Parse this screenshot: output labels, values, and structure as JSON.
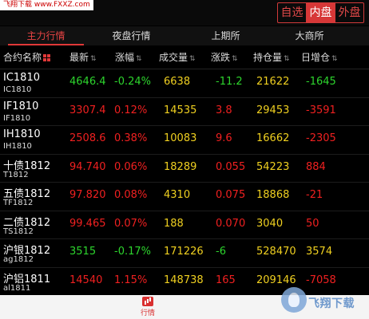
{
  "watermark_top": "飞翔下载 www.FXXZ.com",
  "market_segments": [
    {
      "label": "自选",
      "active": false
    },
    {
      "label": "内盘",
      "active": true
    },
    {
      "label": "外盘",
      "active": false
    }
  ],
  "exchange_tabs": [
    {
      "label": "主力行情",
      "active": true
    },
    {
      "label": "夜盘行情",
      "active": false
    },
    {
      "label": "上期所",
      "active": false
    },
    {
      "label": "大商所",
      "active": false
    }
  ],
  "columns": {
    "name": "合约名称",
    "last": "最新",
    "change_pct": "涨幅",
    "volume": "成交量",
    "change": "涨跌",
    "open_interest": "持仓量",
    "oi_change": "日增仓",
    "sort_glyph": "⇅"
  },
  "rows": [
    {
      "name": "IC1810",
      "code": "IC1810",
      "last": "4646.4",
      "change_pct": "-0.24%",
      "volume": "6638",
      "change": "-11.2",
      "open_interest": "21622",
      "oi_change": "-1645",
      "direction": "down"
    },
    {
      "name": "IF1810",
      "code": "IF1810",
      "last": "3307.4",
      "change_pct": "0.12%",
      "volume": "14535",
      "change": "3.8",
      "open_interest": "29453",
      "oi_change": "-3591",
      "direction": "up"
    },
    {
      "name": "IH1810",
      "code": "IH1810",
      "last": "2508.6",
      "change_pct": "0.38%",
      "volume": "10083",
      "change": "9.6",
      "open_interest": "16662",
      "oi_change": "-2305",
      "direction": "up"
    },
    {
      "name": "十债1812",
      "code": "T1812",
      "last": "94.740",
      "change_pct": "0.06%",
      "volume": "18289",
      "change": "0.055",
      "open_interest": "54223",
      "oi_change": "884",
      "direction": "up"
    },
    {
      "name": "五债1812",
      "code": "TF1812",
      "last": "97.820",
      "change_pct": "0.08%",
      "volume": "4310",
      "change": "0.075",
      "open_interest": "18868",
      "oi_change": "-21",
      "direction": "up"
    },
    {
      "name": "二债1812",
      "code": "TS1812",
      "last": "99.465",
      "change_pct": "0.07%",
      "volume": "188",
      "change": "0.070",
      "open_interest": "3040",
      "oi_change": "50",
      "direction": "up"
    },
    {
      "name": "沪银1812",
      "code": "ag1812",
      "last": "3515",
      "change_pct": "-0.17%",
      "volume": "171226",
      "change": "-6",
      "open_interest": "528470",
      "oi_change": "3574",
      "direction": "down"
    },
    {
      "name": "沪铝1811",
      "code": "al1811",
      "last": "14540",
      "change_pct": "1.15%",
      "volume": "148738",
      "change": "165",
      "open_interest": "209146",
      "oi_change": "-7058",
      "direction": "up"
    }
  ],
  "bottom_nav": {
    "label": "行情",
    "icon": "bar-chart-icon"
  },
  "watermark_logo": "飞翔下载",
  "colors": {
    "accent": "#d73737",
    "up": "#f02020",
    "down": "#2dd52d",
    "volume": "#f0d020"
  }
}
